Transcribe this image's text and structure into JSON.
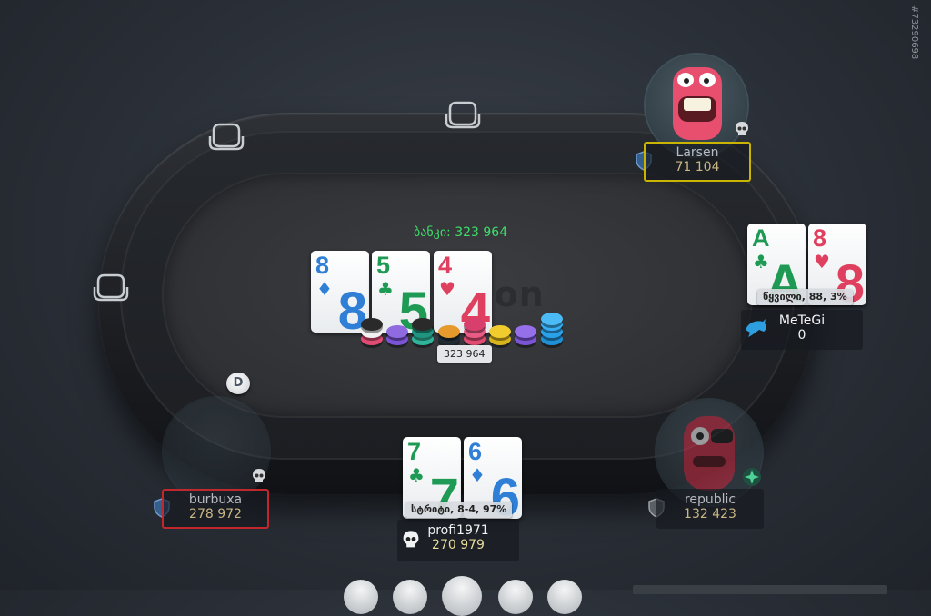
{
  "game": {
    "pot_label": "ბანკი: 323 964",
    "pot_chips_label": "323 964",
    "table_watermark": "son",
    "table_id": "#73290698",
    "dealer_label": "D"
  },
  "board": {
    "cards": [
      {
        "rank": "8",
        "suit": "♦",
        "color": "#2f7fd6"
      },
      {
        "rank": "5",
        "suit": "♣",
        "color": "#1f9a55"
      },
      {
        "rank": "4",
        "suit": "♥",
        "color": "#e0405f"
      }
    ]
  },
  "players": {
    "larsen": {
      "name": "Larsen",
      "chips": "71 104"
    },
    "metegi": {
      "name": "MeTeGi",
      "chips": "0",
      "hand_label": "წყვილი, 88, 3%",
      "cards": [
        {
          "rank": "A",
          "suit": "♣",
          "color": "#1f9a55"
        },
        {
          "rank": "8",
          "suit": "♥",
          "color": "#e0405f"
        }
      ]
    },
    "republic": {
      "name": "republic",
      "chips": "132 423"
    },
    "burbuxa": {
      "name": "burbuxa",
      "chips": "278 972"
    },
    "hero": {
      "name": "profi1971",
      "chips": "270 979",
      "hand_label": "სტრიტი, 8-4, 97%",
      "cards": [
        {
          "rank": "7",
          "suit": "♣",
          "color": "#1f9a55"
        },
        {
          "rank": "6",
          "suit": "♦",
          "color": "#2f7fd6"
        }
      ]
    }
  },
  "colors": {
    "felt": "#313337",
    "pot_text": "#3de06a",
    "chips_text": "#c9b784",
    "larsen_highlight": "#c9b400",
    "burbuxa_highlight": "#c0282d"
  },
  "icons": {
    "empty_seat": "seat-icon",
    "skull": "skull-icon",
    "shield": "shield-icon",
    "dolphin": "dolphin-icon"
  }
}
